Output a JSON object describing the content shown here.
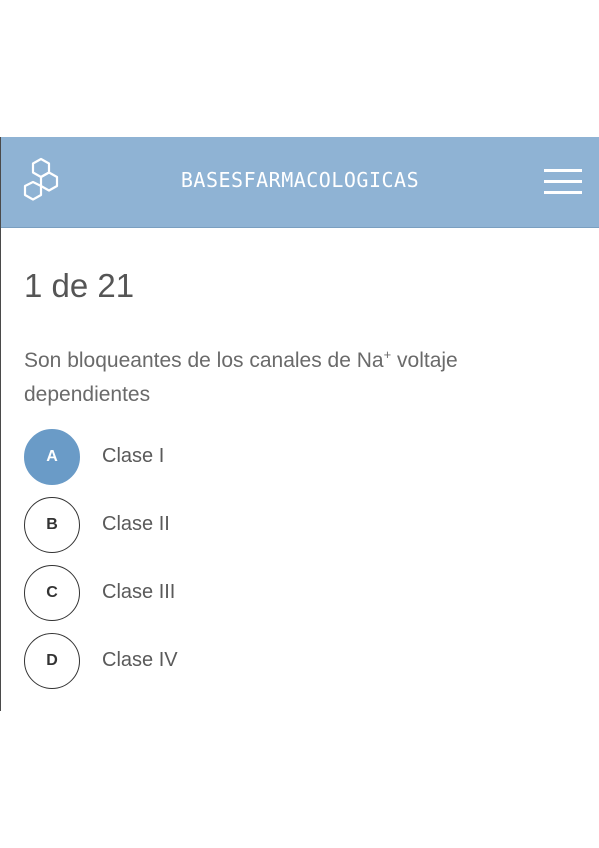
{
  "header": {
    "title": "BASESFARMACOLOGICAS",
    "logo_icon": "molecule-hexagon-icon",
    "menu_icon": "hamburger-menu-icon",
    "background_color": "#8fb3d4"
  },
  "quiz": {
    "counter": "1 de 21",
    "question_pre": "Son bloqueantes de los canales de Na",
    "question_sup": "+",
    "question_post": " voltaje dependientes",
    "options": [
      {
        "letter": "A",
        "label": "Clase I",
        "selected": true
      },
      {
        "letter": "B",
        "label": "Clase II",
        "selected": false
      },
      {
        "letter": "C",
        "label": "Clase III",
        "selected": false
      },
      {
        "letter": "D",
        "label": "Clase IV",
        "selected": false
      }
    ],
    "selected_color": "#6a9bc7"
  }
}
